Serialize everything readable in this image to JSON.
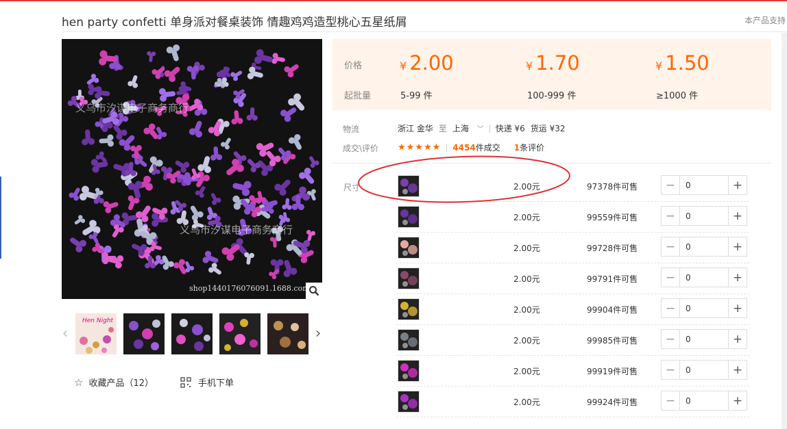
{
  "page": {
    "title": "hen party confetti 单身派对餐桌装饰 情趣鸡鸡造型桃心五星纸屑",
    "support_note": "本产品支持"
  },
  "gallery": {
    "watermark_center": "义乌市汐谋电子商务商行",
    "watermark_top": "义乌市汐谋电子商务商行",
    "watermark_url": "shop1440176076091.1688.com",
    "thumbnails": [
      {
        "name": "hen-night",
        "text": "Hen Night"
      },
      {
        "name": "purple-mix",
        "text": ""
      },
      {
        "name": "purple-mix-2",
        "text": ""
      },
      {
        "name": "pink-gold",
        "text": ""
      },
      {
        "name": "gold-dark",
        "text": ""
      }
    ]
  },
  "actions": {
    "favorite_label": "收藏产品",
    "favorite_count": "（12）",
    "mobile_order_label": "手机下单"
  },
  "pricing": {
    "price_label": "价格",
    "moq_label": "起批量",
    "currency": "¥",
    "tiers": [
      {
        "price": "2.00",
        "range": "5-99 件"
      },
      {
        "price": "1.70",
        "range": "100-999 件"
      },
      {
        "price": "1.50",
        "range": "≥1000 件"
      }
    ]
  },
  "logistics": {
    "label": "物流",
    "from": "浙江 金华",
    "to_word": "至",
    "to": "上海",
    "express": "快递 ¥6",
    "freight": "货运 ¥32"
  },
  "reviews": {
    "label": "成交\\评价",
    "stars": "★★★★★",
    "deals_count": "4454",
    "deals_text": "件成交",
    "review_count": "1",
    "review_text": "条评价"
  },
  "sku": {
    "label": "尺寸",
    "rows": [
      {
        "color": "#7a3fb0",
        "price": "2.00元",
        "stock": "97378件可售",
        "qty": "0"
      },
      {
        "color": "#6a35a0",
        "price": "2.00元",
        "stock": "99559件可售",
        "qty": "0"
      },
      {
        "color": "#e8a8a0",
        "price": "2.00元",
        "stock": "99728件可售",
        "qty": "0"
      },
      {
        "color": "#8a4a6a",
        "price": "2.00元",
        "stock": "99791件可售",
        "qty": "0"
      },
      {
        "color": "#d8b030",
        "price": "2.00元",
        "stock": "99904件可售",
        "qty": "0"
      },
      {
        "color": "#7a8088",
        "price": "2.00元",
        "stock": "99985件可售",
        "qty": "0"
      },
      {
        "color": "#d030c0",
        "price": "2.00元",
        "stock": "99919件可售",
        "qty": "0"
      },
      {
        "color": "#b030c8",
        "price": "2.00元",
        "stock": "99924件可售",
        "qty": "0"
      }
    ]
  }
}
